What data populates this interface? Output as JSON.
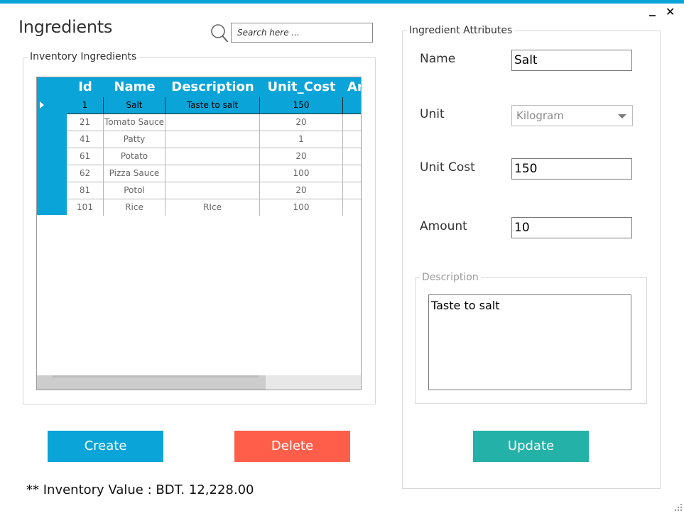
{
  "window": {
    "minimize_glyph": "_",
    "close_glyph": "✕",
    "accent_color": "#0aa4d8"
  },
  "header": {
    "title": "Ingredients",
    "search_placeholder": "Search here ..."
  },
  "inventory": {
    "legend": "Inventory Ingredients",
    "columns": [
      "Id",
      "Name",
      "Description",
      "Unit_Cost",
      "Ar"
    ],
    "rows": [
      {
        "id": "1",
        "name": "Salt",
        "description": "Taste to salt",
        "unit_cost": "150",
        "selected": true
      },
      {
        "id": "21",
        "name": "Tomato Sauce",
        "description": "",
        "unit_cost": "20"
      },
      {
        "id": "41",
        "name": "Patty",
        "description": "",
        "unit_cost": "1"
      },
      {
        "id": "61",
        "name": "Potato",
        "description": "",
        "unit_cost": "20"
      },
      {
        "id": "62",
        "name": "Pizza Sauce",
        "description": "",
        "unit_cost": "100"
      },
      {
        "id": "81",
        "name": "Potol",
        "description": "",
        "unit_cost": "20"
      },
      {
        "id": "101",
        "name": "Rice",
        "description": "RIce",
        "unit_cost": "100"
      }
    ]
  },
  "attributes": {
    "legend": "Ingredient Attributes",
    "name_label": "Name",
    "name_value": "Salt",
    "unit_label": "Unit",
    "unit_value": "Kilogram",
    "unit_cost_label": "Unit Cost",
    "unit_cost_value": "150",
    "amount_label": "Amount",
    "amount_value": "10",
    "description_legend": "Description",
    "description_value": "Taste to salt"
  },
  "actions": {
    "create_label": "Create",
    "delete_label": "Delete",
    "update_label": "Update",
    "create_color": "#0aa4d8",
    "delete_color": "#ff5e4a",
    "update_color": "#24b1a7"
  },
  "footer": {
    "inventory_value": "** Inventory Value : BDT. 12,228.00"
  },
  "icons": {
    "search": "search-icon",
    "minimize": "minimize-icon",
    "close": "close-icon",
    "row_pointer": "row-pointer-icon",
    "dropdown": "chevron-down-icon",
    "resize": "resize-grip-icon"
  }
}
